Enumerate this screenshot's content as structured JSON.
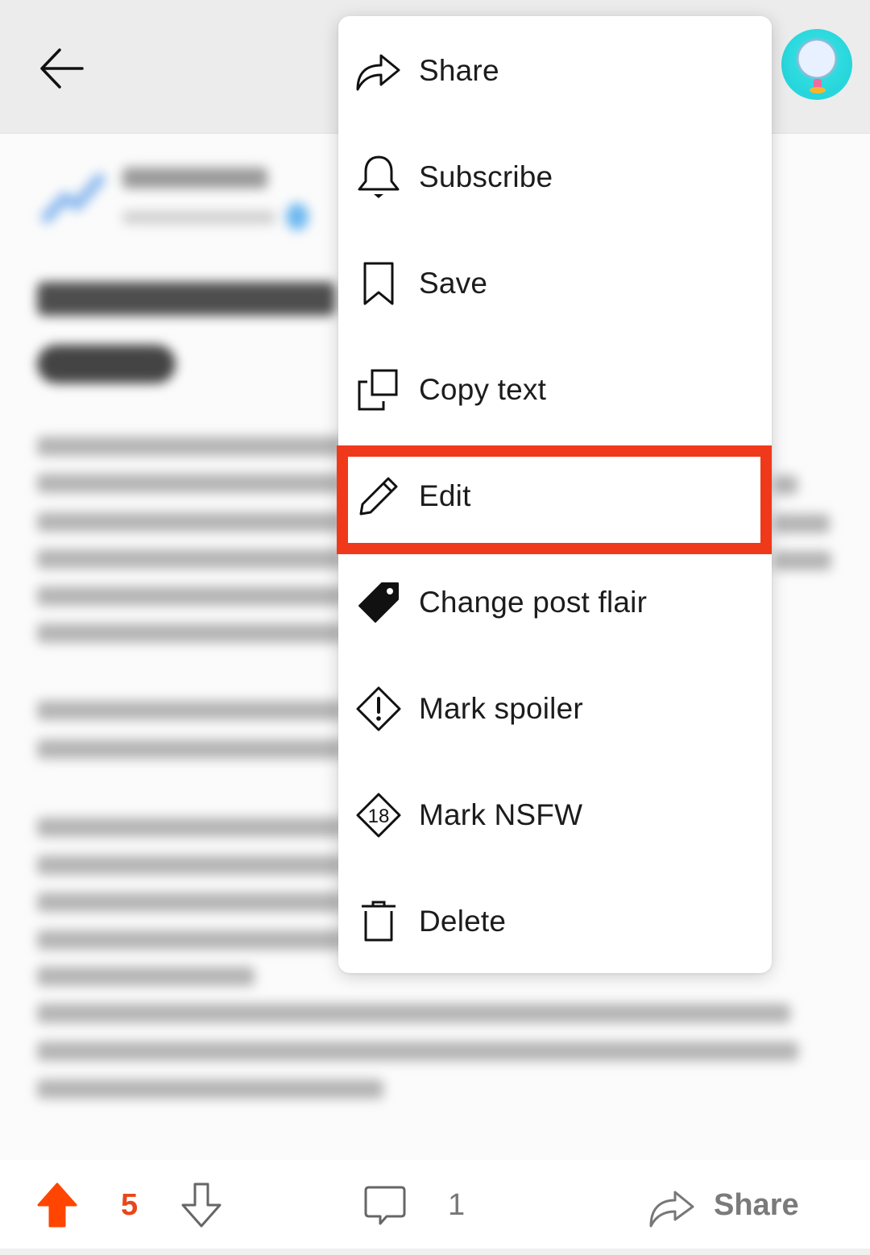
{
  "header": {
    "back_icon": "arrow-left-icon",
    "avatar_icon": "user-avatar"
  },
  "post": {
    "note": "Post content behind menu is blurred and unreadable"
  },
  "menu": {
    "items": [
      {
        "id": "share",
        "label": "Share",
        "icon": "share-arrow-icon"
      },
      {
        "id": "subscribe",
        "label": "Subscribe",
        "icon": "bell-icon"
      },
      {
        "id": "save",
        "label": "Save",
        "icon": "bookmark-icon"
      },
      {
        "id": "copy-text",
        "label": "Copy text",
        "icon": "copy-icon"
      },
      {
        "id": "edit",
        "label": "Edit",
        "icon": "pencil-icon",
        "highlighted": true
      },
      {
        "id": "change-post-flair",
        "label": "Change post flair",
        "icon": "tag-icon"
      },
      {
        "id": "mark-spoiler",
        "label": "Mark spoiler",
        "icon": "spoiler-diamond-icon"
      },
      {
        "id": "mark-nsfw",
        "label": "Mark NSFW",
        "icon": "nsfw-18-icon"
      },
      {
        "id": "delete",
        "label": "Delete",
        "icon": "trash-icon"
      }
    ],
    "highlight_color": "#f0391a"
  },
  "bottom_bar": {
    "vote_count": "5",
    "comment_count": "1",
    "share_label": "Share",
    "upvote_color": "#ff4500"
  }
}
